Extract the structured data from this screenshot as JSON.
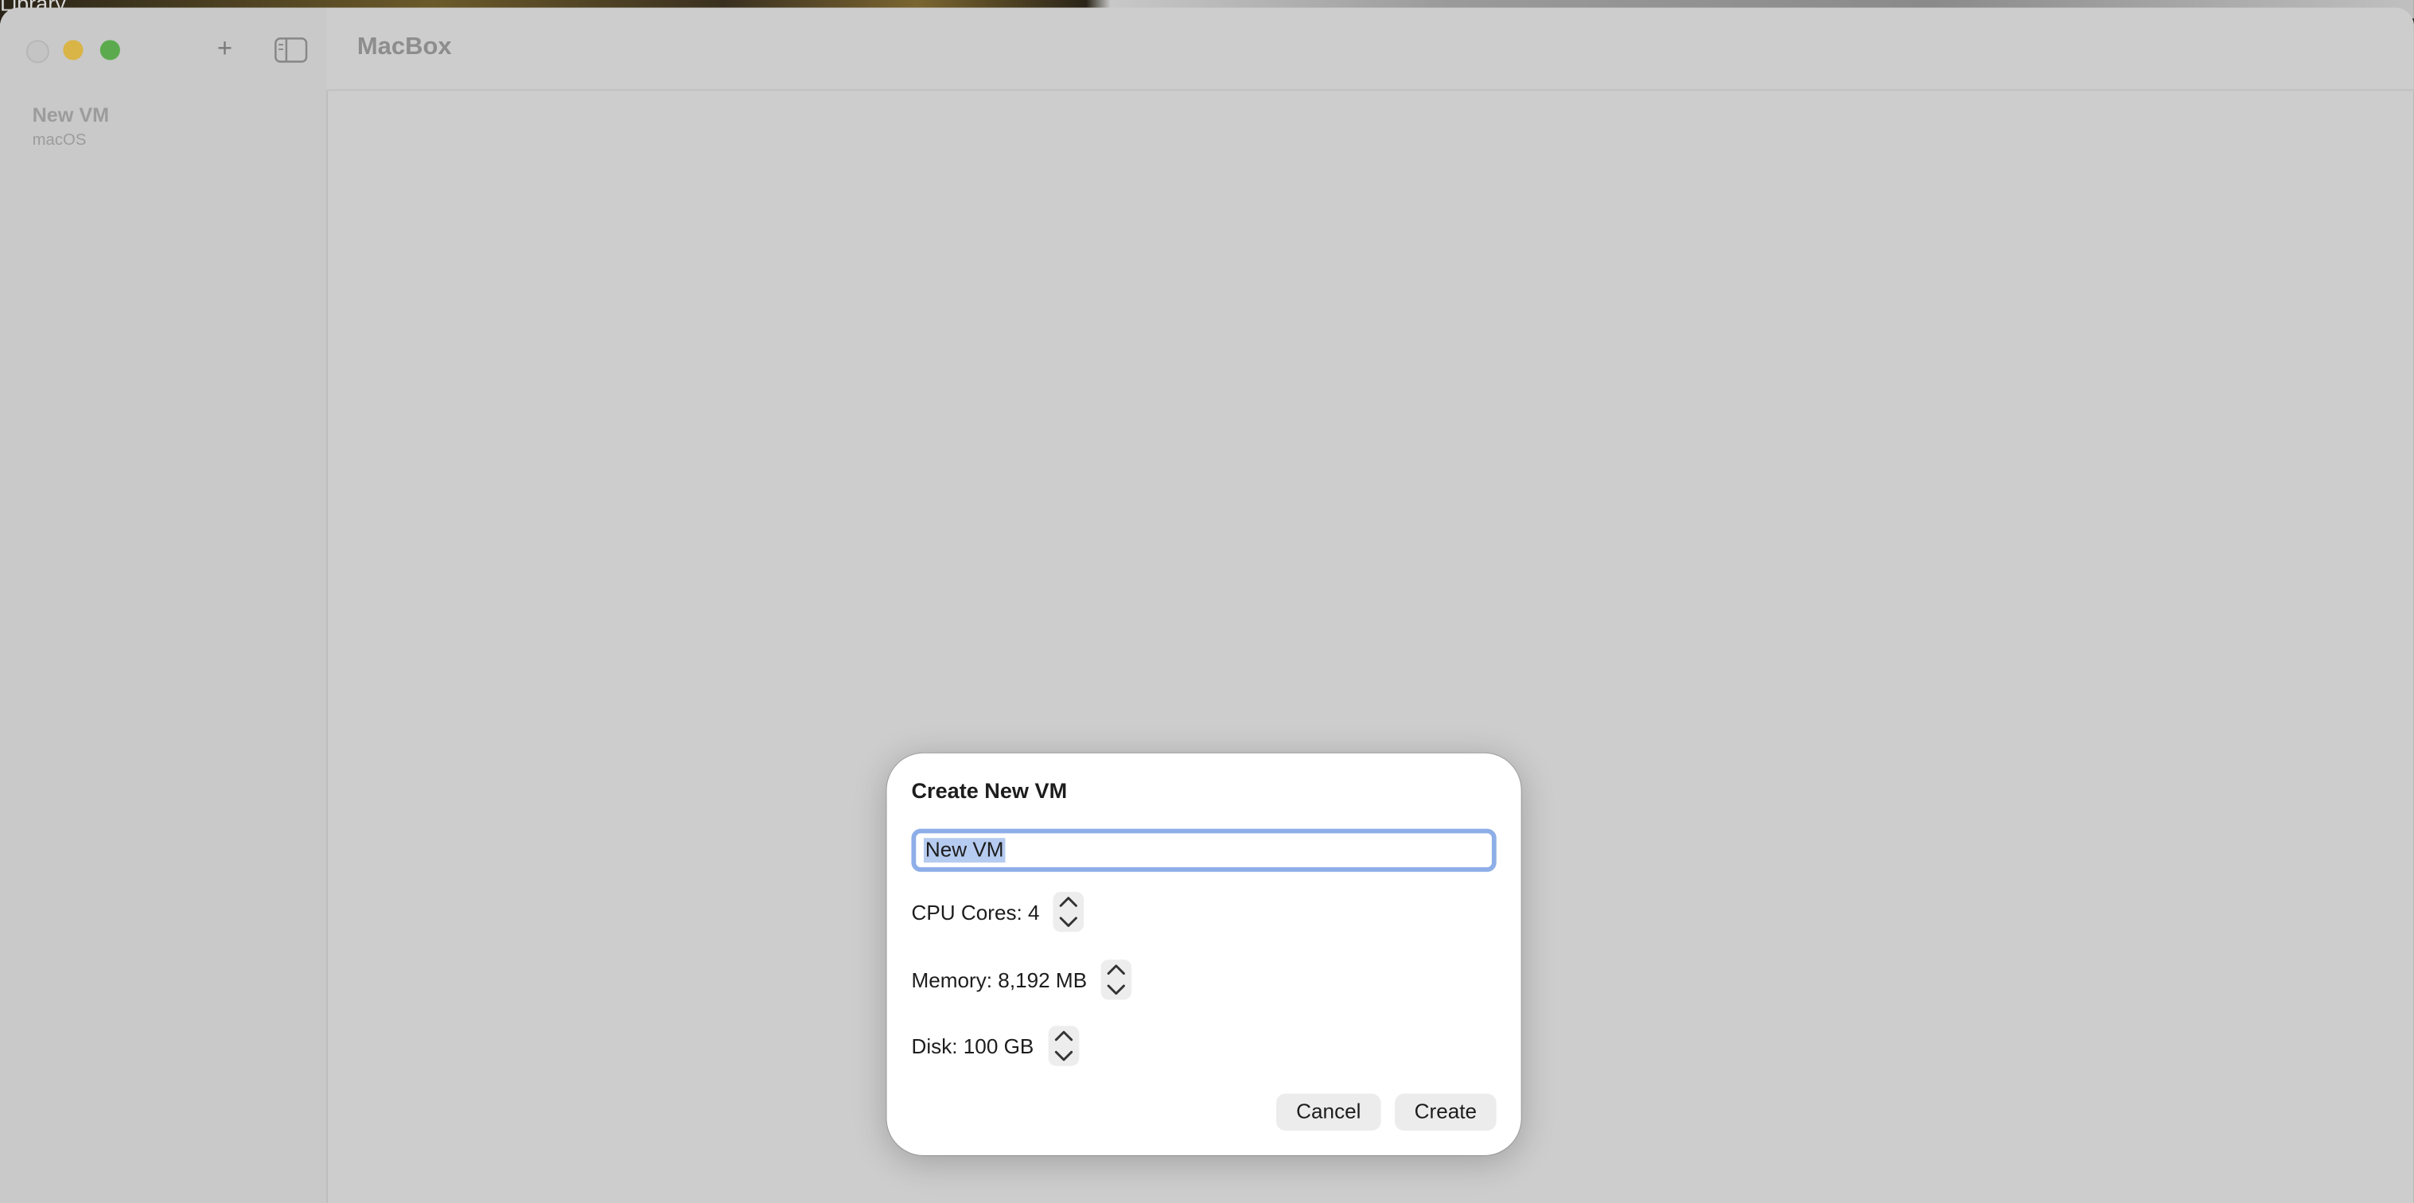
{
  "background": {
    "library_label": "Library"
  },
  "window": {
    "app_title": "MacBox",
    "toolbar": {
      "add_label": "+"
    },
    "sidebar": {
      "items": [
        {
          "name": "New VM",
          "os": "macOS"
        }
      ]
    }
  },
  "dialog": {
    "title": "Create New VM",
    "name_input": {
      "value": "New VM"
    },
    "cpu": {
      "label": "CPU Cores: 4"
    },
    "memory": {
      "label": "Memory: 8,192 MB"
    },
    "disk": {
      "label": "Disk: 100 GB"
    },
    "cancel_label": "Cancel",
    "create_label": "Create"
  },
  "colors": {
    "selection": "#b6cbf0",
    "focus_ring": "#8eaee8",
    "traffic_min": "#d9b446",
    "traffic_max": "#5bab4e"
  }
}
